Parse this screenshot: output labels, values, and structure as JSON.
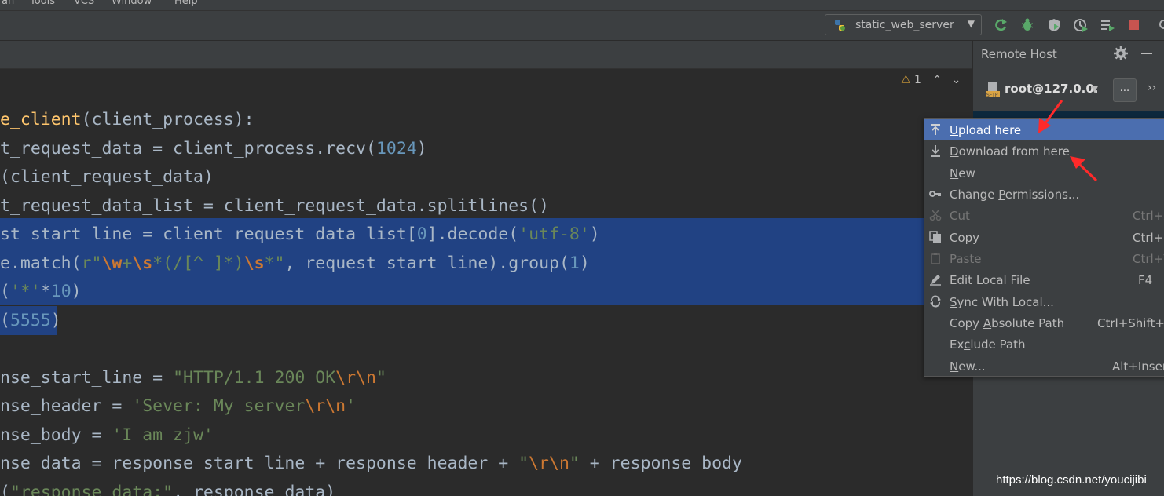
{
  "menubar": {
    "items": [
      "an",
      "Tools",
      "VCS",
      "Window",
      "Help"
    ]
  },
  "toolbar": {
    "run_config": "static_web_server",
    "icons": [
      "rerun-icon",
      "debug-icon",
      "coverage-icon",
      "profile-icon",
      "run-list-icon",
      "stop-icon"
    ]
  },
  "editor": {
    "inspection_count": "1",
    "lines": [
      [
        {
          "t": "e_client",
          "c": "fn"
        },
        {
          "t": "(client_process):",
          "c": ""
        }
      ],
      [
        {
          "t": "t_request_data = client_process.recv(",
          "c": ""
        },
        {
          "t": "1024",
          "c": "num"
        },
        {
          "t": ")",
          "c": ""
        }
      ],
      [
        {
          "t": "(client_request_data)",
          "c": ""
        }
      ],
      [
        {
          "t": "t_request_data_list = client_request_data.splitlines()",
          "c": ""
        }
      ],
      [
        {
          "t": "st_start_line = client_request_data_list[",
          "c": ""
        },
        {
          "t": "0",
          "c": "num"
        },
        {
          "t": "].decode(",
          "c": ""
        },
        {
          "t": "'utf-8'",
          "c": "str"
        },
        {
          "t": ")",
          "c": ""
        }
      ],
      [
        {
          "t": "e.match(",
          "c": ""
        },
        {
          "t": "r\"",
          "c": "str"
        },
        {
          "t": "\\w",
          "c": "rx"
        },
        {
          "t": "+",
          "c": "str"
        },
        {
          "t": "\\s",
          "c": "rx"
        },
        {
          "t": "*(/[^ ]*)",
          "c": "str"
        },
        {
          "t": "\\s",
          "c": "rx"
        },
        {
          "t": "*\"",
          "c": "str"
        },
        {
          "t": ", request_start_line).group(",
          "c": ""
        },
        {
          "t": "1",
          "c": "num"
        },
        {
          "t": ")",
          "c": ""
        }
      ],
      [
        {
          "t": "(",
          "c": ""
        },
        {
          "t": "'*'",
          "c": "str"
        },
        {
          "t": "*",
          "c": ""
        },
        {
          "t": "10",
          "c": "num"
        },
        {
          "t": ")",
          "c": ""
        }
      ],
      [
        {
          "t": "(",
          "c": ""
        },
        {
          "t": "5555",
          "c": "num"
        },
        {
          "t": ")",
          "c": ""
        }
      ],
      [],
      [
        {
          "t": "nse_start_line = ",
          "c": ""
        },
        {
          "t": "\"HTTP/1.1 200 OK",
          "c": "str"
        },
        {
          "t": "\\r\\n",
          "c": "esc"
        },
        {
          "t": "\"",
          "c": "str"
        }
      ],
      [
        {
          "t": "nse_header = ",
          "c": ""
        },
        {
          "t": "'Sever: My server",
          "c": "str"
        },
        {
          "t": "\\r\\n",
          "c": "esc"
        },
        {
          "t": "'",
          "c": "str"
        }
      ],
      [
        {
          "t": "nse_body = ",
          "c": ""
        },
        {
          "t": "'I am zjw'",
          "c": "str"
        }
      ],
      [
        {
          "t": "nse_data = response_start_line + response_header + ",
          "c": ""
        },
        {
          "t": "\"",
          "c": "str"
        },
        {
          "t": "\\r\\n",
          "c": "esc"
        },
        {
          "t": "\"",
          "c": "str"
        },
        {
          "t": " + response_body",
          "c": ""
        }
      ],
      [
        {
          "t": "(",
          "c": ""
        },
        {
          "t": "\"response data:\"",
          "c": "str"
        },
        {
          "t": ", response_data)",
          "c": ""
        }
      ]
    ]
  },
  "remote_host": {
    "title": "Remote Host",
    "host": "root@127.0.0.",
    "more_label": "...",
    "watermark": "https://blog.csdn.net/youcijibi"
  },
  "context_menu": {
    "items": [
      {
        "label": "Upload here",
        "mnemonic": "U",
        "shortcut": "",
        "icon": "upload-icon",
        "active": true,
        "disabled": false
      },
      {
        "label": "Download from here",
        "mnemonic": "D",
        "shortcut": "",
        "icon": "download-icon",
        "active": false,
        "disabled": false
      },
      {
        "label": "New",
        "mnemonic": "N",
        "shortcut": "",
        "icon": "",
        "active": false,
        "disabled": false
      },
      {
        "label": "Change Permissions...",
        "mnemonic": "P",
        "shortcut": "",
        "icon": "key-icon",
        "active": false,
        "disabled": false
      },
      {
        "label": "Cut",
        "mnemonic": "t",
        "shortcut": "Ctrl+X",
        "icon": "scissors-icon",
        "active": false,
        "disabled": true
      },
      {
        "label": "Copy",
        "mnemonic": "C",
        "shortcut": "Ctrl+C",
        "icon": "copy-icon",
        "active": false,
        "disabled": false
      },
      {
        "label": "Paste",
        "mnemonic": "P",
        "shortcut": "Ctrl+V",
        "icon": "paste-icon",
        "active": false,
        "disabled": true
      },
      {
        "label": "Edit Local File",
        "mnemonic": "",
        "shortcut": "F4",
        "icon": "pencil-icon",
        "active": false,
        "disabled": false
      },
      {
        "label": "Sync With Local...",
        "mnemonic": "S",
        "shortcut": "",
        "icon": "sync-icon",
        "active": false,
        "disabled": false
      },
      {
        "label": "Copy Absolute Path",
        "mnemonic": "A",
        "shortcut": "Ctrl+Shift+C",
        "icon": "",
        "active": false,
        "disabled": false
      },
      {
        "label": "Exclude Path",
        "mnemonic": "c",
        "shortcut": "",
        "icon": "",
        "active": false,
        "disabled": false
      },
      {
        "label": "New...",
        "mnemonic": "N",
        "shortcut": "Alt+Insert",
        "icon": "",
        "active": false,
        "disabled": false
      }
    ]
  },
  "colors": {
    "editor_bg": "#2b2b2b",
    "panel_bg": "#3c3f41",
    "selection": "#214283",
    "menu_active": "#4b6eaf",
    "annotation_red": "#ff2a2a"
  }
}
